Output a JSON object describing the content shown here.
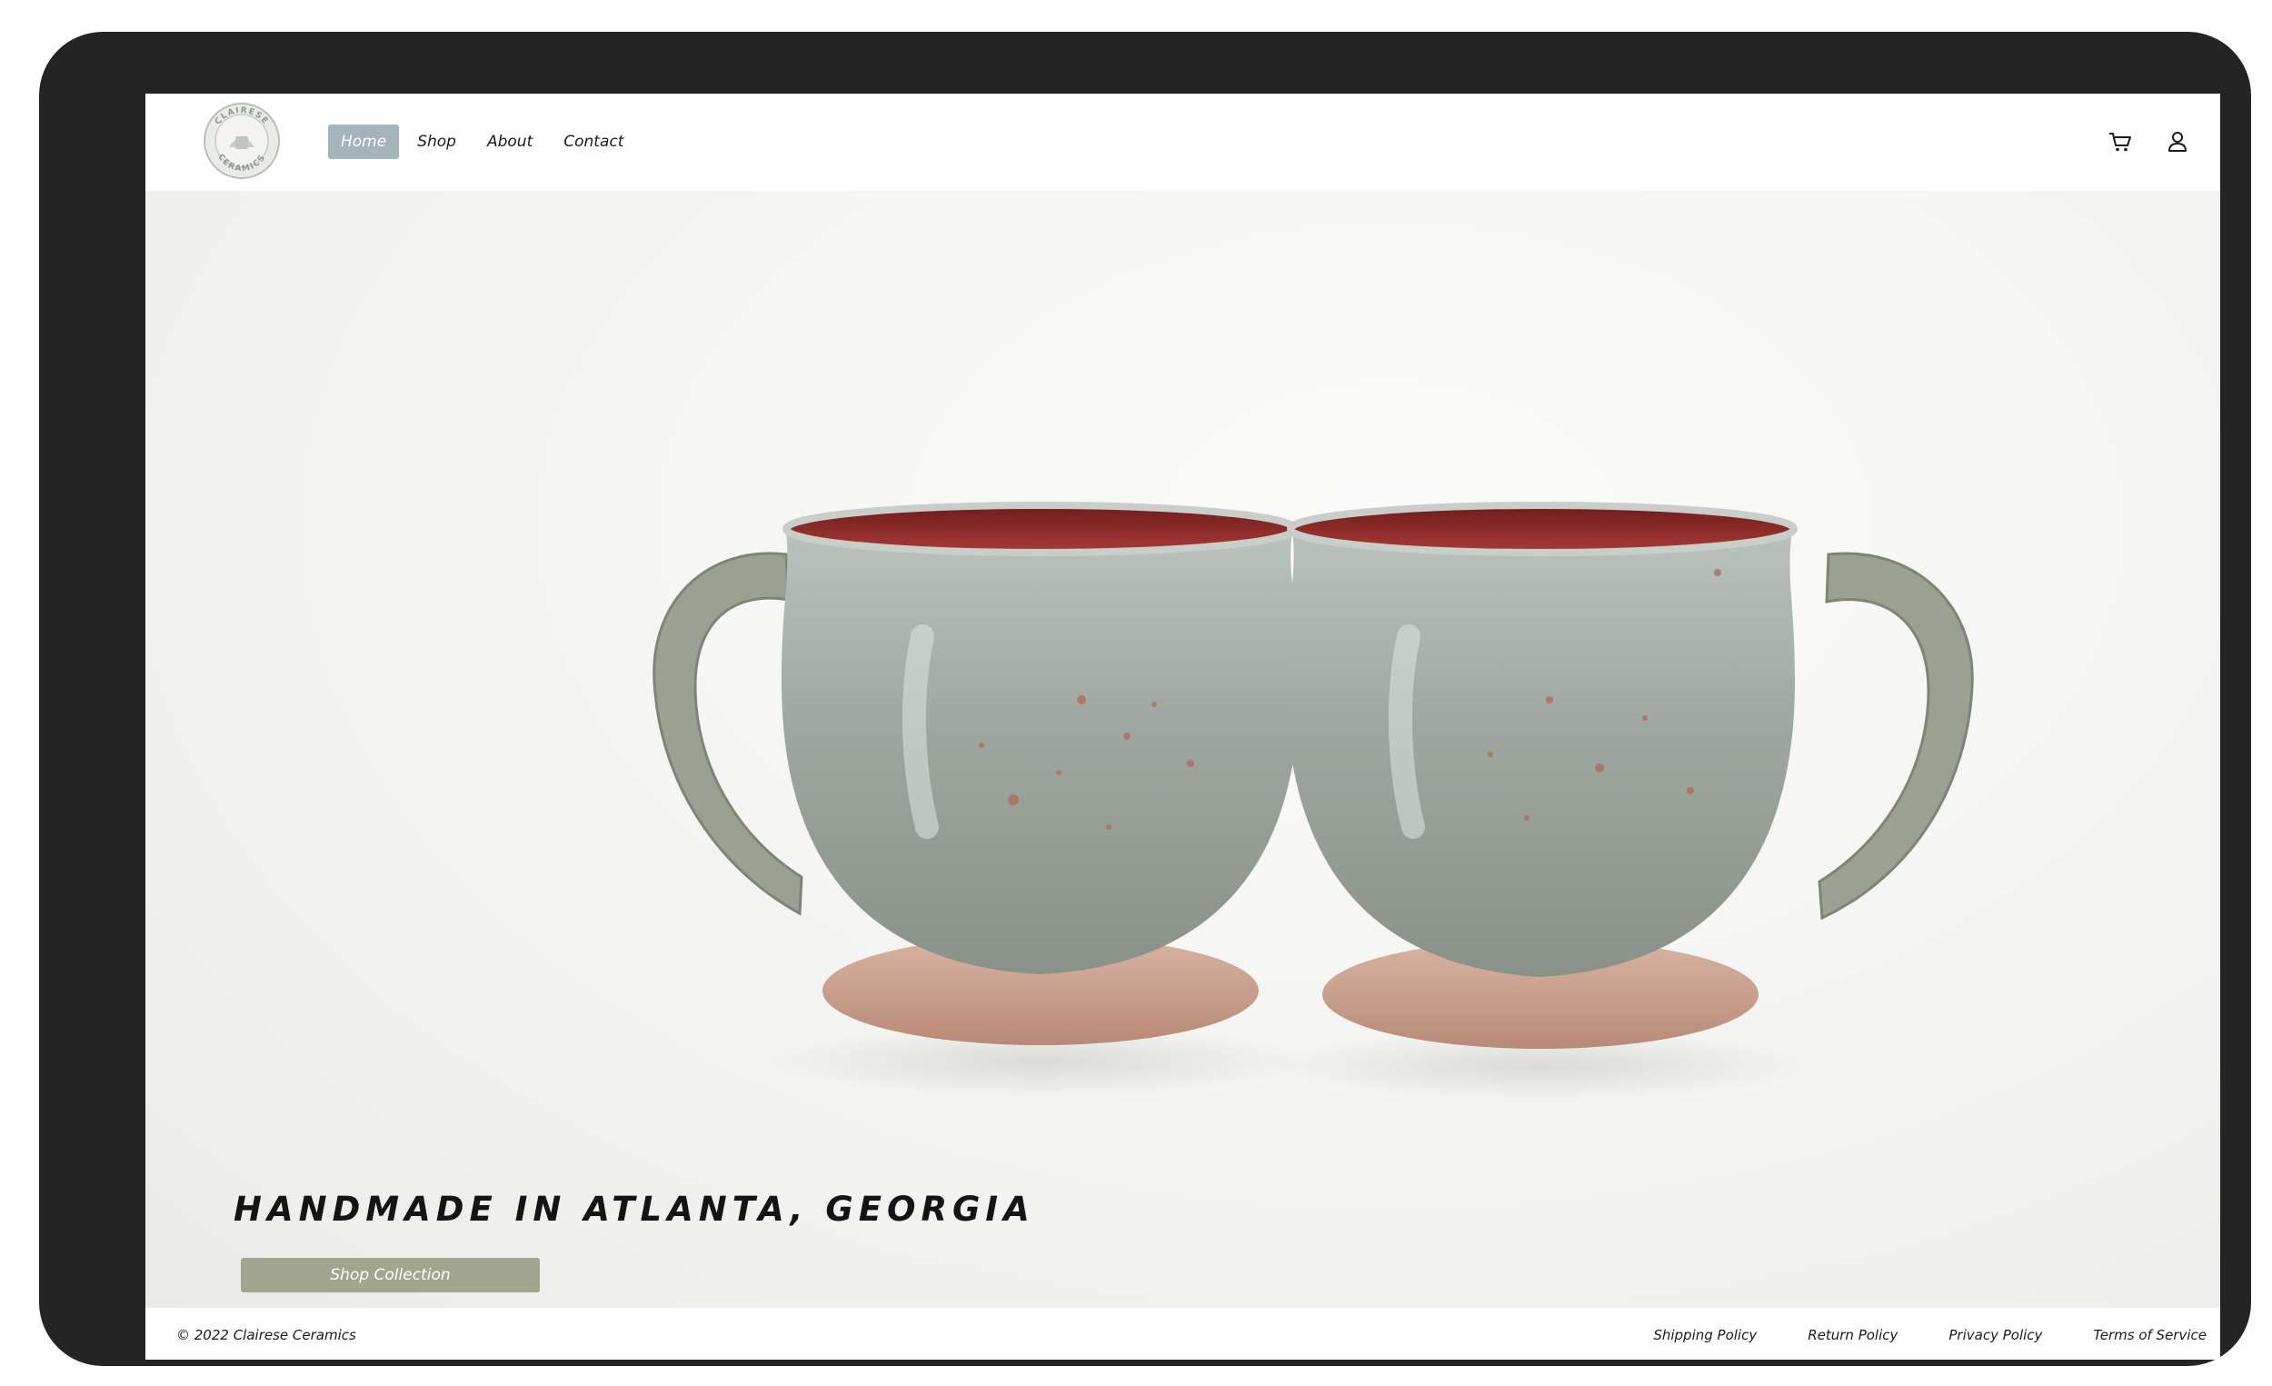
{
  "brand": {
    "logo_text_top": "CLAIRESE",
    "logo_text_bottom": "CERAMICS"
  },
  "nav": {
    "items": [
      {
        "label": "Home",
        "active": true
      },
      {
        "label": "Shop",
        "active": false
      },
      {
        "label": "About",
        "active": false
      },
      {
        "label": "Contact",
        "active": false
      }
    ]
  },
  "header_icons": {
    "cart": "cart-icon",
    "account": "user-icon"
  },
  "hero": {
    "title": "HANDMADE IN ATLANTA, GEORGIA",
    "button_label": "Shop Collection",
    "image_subject": "two-ceramic-mugs"
  },
  "footer": {
    "copyright": "© 2022 Clairese Ceramics",
    "links": [
      "Shipping Policy",
      "Return Policy",
      "Privacy Policy",
      "Terms of Service"
    ]
  },
  "colors": {
    "frame": "#242424",
    "nav_active_bg": "#a7b3bb",
    "button_bg": "#a3a68f",
    "mug_glaze": "#9aa39b",
    "mug_interior": "#8e2a28",
    "mug_foot": "#c9a08e"
  }
}
